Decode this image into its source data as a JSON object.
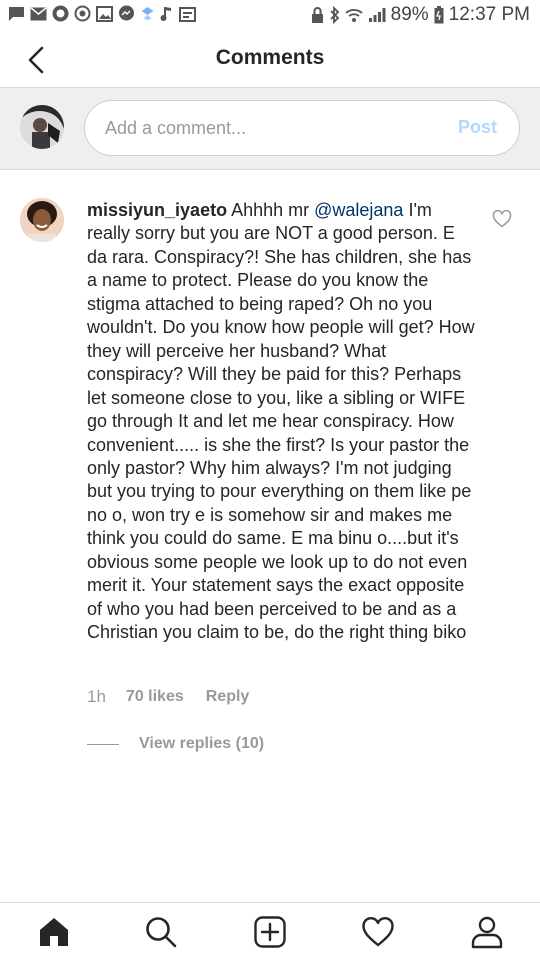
{
  "status_bar": {
    "battery": "89%",
    "time": "12:37 PM"
  },
  "header": {
    "title": "Comments"
  },
  "composer": {
    "placeholder": "Add a comment...",
    "post_label": "Post"
  },
  "comment": {
    "username": "missiyun_iyaeto",
    "text_before_mention": " Ahhhh mr ",
    "mention": "@walejana",
    "text_after_mention": " I'm really sorry but you are NOT a good person. E da rara. Conspiracy?! She has children, she has a name to protect. Please do you know the stigma attached to being raped? Oh no you wouldn't. Do you know how people will get? How they will perceive her husband? What conspiracy? Will they be paid for this? Perhaps let someone close to you, like a sibling or WIFE go through It and let me hear conspiracy. How convenient..... is she the first? Is your pastor the only pastor? Why him always? I'm not judging but you trying to pour everything on them like pe no o, won try e is somehow sir and makes me think you could do same. E ma binu o....but it's obvious some people we look up to do not even merit it. Your statement says the exact opposite of who you had been perceived to be and as a Christian you claim to be, do the right thing biko",
    "time": "1h",
    "likes": "70 likes",
    "reply_label": "Reply",
    "view_replies": "View replies (10)"
  },
  "bottom_nav": {
    "items": [
      "home-icon",
      "search-icon",
      "add-post-icon",
      "activity-heart-icon",
      "profile-icon"
    ]
  },
  "colors": {
    "mention": "#003569",
    "post_disabled": "#b3d8fb",
    "secondary_text": "#999999",
    "composer_bg": "#efefef"
  }
}
